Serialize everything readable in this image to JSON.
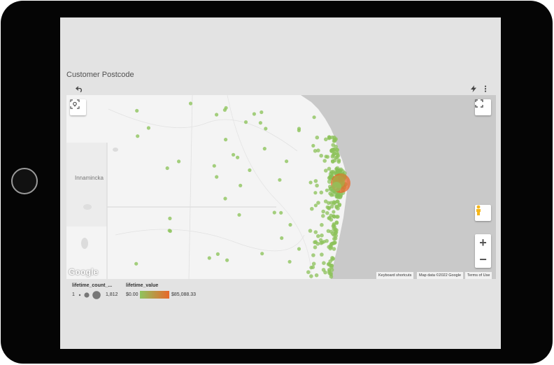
{
  "device": {
    "type": "tablet"
  },
  "chart": {
    "title": "Customer Postcode"
  },
  "map": {
    "place_label": "Innamincka",
    "logo": "Google",
    "attribution": {
      "keyboard": "Keyboard shortcuts",
      "map_data": "Map data ©2022 Google",
      "terms": "Terms of Use"
    },
    "controls": [
      "undo-icon",
      "lightning-icon",
      "more-vert-icon",
      "locate-icon",
      "fullscreen-icon",
      "pegman-icon"
    ],
    "zoom_in": "+",
    "zoom_out": "−",
    "colors": {
      "water": "#c9c9c9",
      "land": "#f4f4f4",
      "bubble_low": "#8fc45e",
      "bubble_high": "#e8672a"
    }
  },
  "legend": {
    "size_label": "lifetime_count_...",
    "size_min": "1",
    "size_max": "1,812",
    "color_label": "lifetime_value",
    "color_min": "$0.00",
    "color_max": "$85,088.33"
  }
}
